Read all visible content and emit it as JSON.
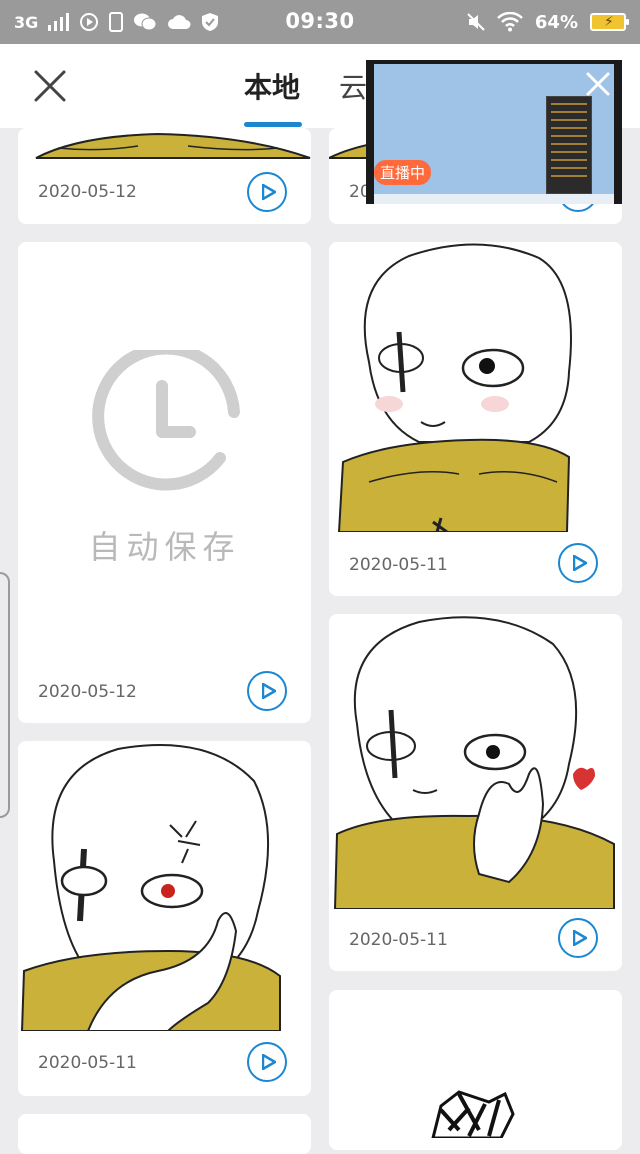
{
  "status_bar": {
    "network": "3G",
    "time": "09:30",
    "battery": "64%"
  },
  "header": {
    "tabs": [
      {
        "label": "本地"
      },
      {
        "label": "云"
      }
    ]
  },
  "pip": {
    "live_label": "直播中"
  },
  "cards": [
    {
      "date": "2020-05-12"
    },
    {
      "date": "2020-05-12"
    },
    {
      "date": "2020-05-12",
      "label": "自动保存"
    },
    {
      "date": "2020-05-11"
    },
    {
      "date": "2020-05-11"
    },
    {
      "date": "2020-05-11"
    }
  ],
  "colors": {
    "accent": "#1b87d2",
    "scarf": "#c9b13a",
    "live_badge": "#ff6a3d"
  }
}
